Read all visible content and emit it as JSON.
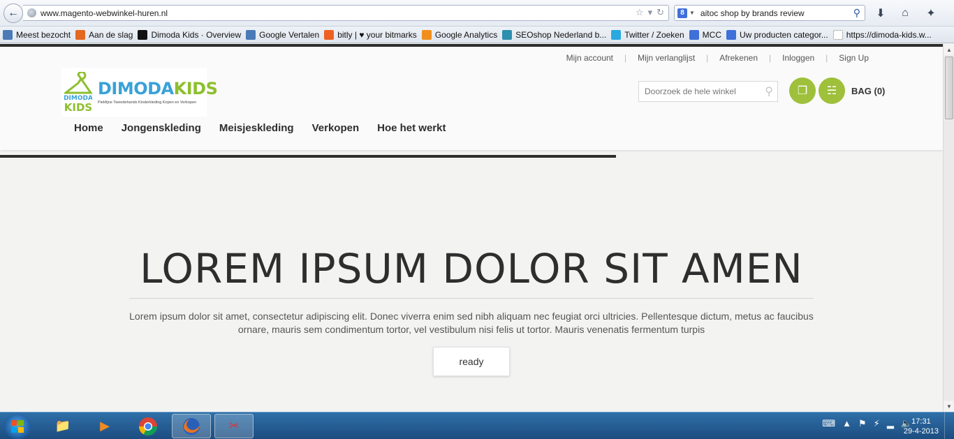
{
  "browser": {
    "url": "www.magento-webwinkel-huren.nl",
    "search_query": "aitoc shop by brands review",
    "search_engine_icon": "google-icon",
    "bookmarks": [
      {
        "label": "Meest bezocht",
        "icon": "most-visited-icon",
        "color": "#4a7ab8"
      },
      {
        "label": "Aan de slag",
        "icon": "firefox-icon",
        "color": "#e4681f"
      },
      {
        "label": "Dimoda Kids · Overview",
        "icon": "p-icon",
        "color": "#111111"
      },
      {
        "label": "Google Vertalen",
        "icon": "translate-icon",
        "color": "#4a7ab8"
      },
      {
        "label": "bitly | ♥ your bitmarks",
        "icon": "bitly-icon",
        "color": "#ee6123"
      },
      {
        "label": "Google Analytics",
        "icon": "analytics-icon",
        "color": "#f28f1c"
      },
      {
        "label": "SEOshop Nederland b...",
        "icon": "seoshop-icon",
        "color": "#2d8fb0"
      },
      {
        "label": "Twitter / Zoeken",
        "icon": "twitter-icon",
        "color": "#2aa9e0"
      },
      {
        "label": "MCC",
        "icon": "google-icon",
        "color": "#3f6fd8"
      },
      {
        "label": "Uw producten categor...",
        "icon": "google-icon",
        "color": "#3f6fd8"
      },
      {
        "label": "https://dimoda-kids.w...",
        "icon": "blank-page-icon",
        "color": "#ffffff"
      }
    ]
  },
  "site": {
    "account_links": [
      "Mijn account",
      "Mijn verlanglijst",
      "Afrekenen",
      "Inloggen",
      "Sign Up"
    ],
    "logo": {
      "word_1": "DIMODA",
      "word_2": "KIDS",
      "hanger_text_1": "DIMODA",
      "hanger_text_2": "KIDS",
      "tagline": "Piekfijne Tweedehands Kinderkleding Kopen en Verkopen",
      "blue": "#39a2d8",
      "green": "#8dbf2e"
    },
    "nav": [
      "Home",
      "Jongenskleding",
      "Meisjeskleding",
      "Verkopen",
      "Hoe het werkt"
    ],
    "search_placeholder": "Doorzoek de hele winkel",
    "bag_label": "BAG (0)",
    "accent_color": "#9fc03b"
  },
  "hero": {
    "title": "LOREM IPSUM DOLOR SIT AMEN",
    "text_line_1": "Lorem ipsum dolor sit amet, consectetur adipiscing elit. Donec viverra enim sed nibh aliquam nec feugiat orci ultricies. Pellentesque dictum, metus ac faucibus",
    "text_line_2": "ornare, mauris sem condimentum tortor, vel vestibulum nisi felis ut tortor. Mauris venenatis fermentum turpis",
    "button_label": "ready"
  },
  "taskbar": {
    "apps": [
      "explorer-icon",
      "media-player-icon",
      "chrome-icon",
      "firefox-icon",
      "snipping-tool-icon"
    ],
    "time": "17:31",
    "date": "29-4-2013"
  }
}
